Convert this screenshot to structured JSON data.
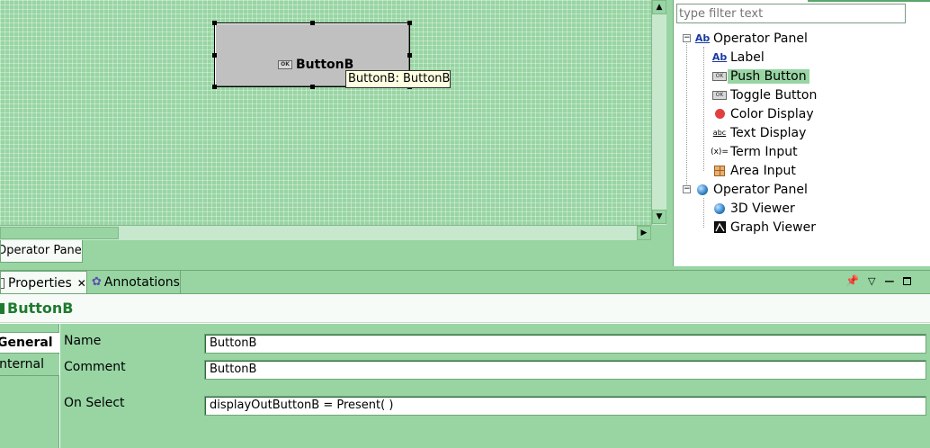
{
  "canvas": {
    "widget_label": "ButtonB",
    "tooltip": "ButtonB: ButtonB",
    "editor_tab": "Operator Panel"
  },
  "palette": {
    "filter_placeholder": "type filter text",
    "groups": [
      {
        "label": "Operator Panel",
        "icon": "text-widget-icon",
        "items": [
          {
            "label": "Label",
            "icon": "label-icon"
          },
          {
            "label": "Push Button",
            "icon": "push-button-icon",
            "selected": true
          },
          {
            "label": "Toggle Button",
            "icon": "toggle-button-icon"
          },
          {
            "label": "Color Display",
            "icon": "color-display-icon",
            "color": "#e04040"
          },
          {
            "label": "Text Display",
            "icon": "text-display-icon"
          },
          {
            "label": "Term Input",
            "icon": "term-input-icon"
          },
          {
            "label": "Area Input",
            "icon": "area-input-icon"
          }
        ]
      },
      {
        "label": "Operator Panel",
        "icon": "globe-icon",
        "items": [
          {
            "label": "3D Viewer",
            "icon": "globe-icon"
          },
          {
            "label": "Graph Viewer",
            "icon": "graph-icon"
          }
        ]
      }
    ]
  },
  "properties_view": {
    "tabs": [
      {
        "label": "Properties",
        "active": true
      },
      {
        "label": "Annotations",
        "active": false
      }
    ],
    "title": "ButtonB",
    "side_tabs": [
      "General",
      "Internal"
    ],
    "fields": [
      {
        "label": "Name",
        "value": "ButtonB"
      },
      {
        "label": "Comment",
        "value": "ButtonB"
      },
      {
        "label": "On Select",
        "value": "displayOutButtonB = Present( )"
      }
    ]
  },
  "colors": {
    "theme_green": "#98d5a3",
    "title_green": "#1e7a2f"
  }
}
